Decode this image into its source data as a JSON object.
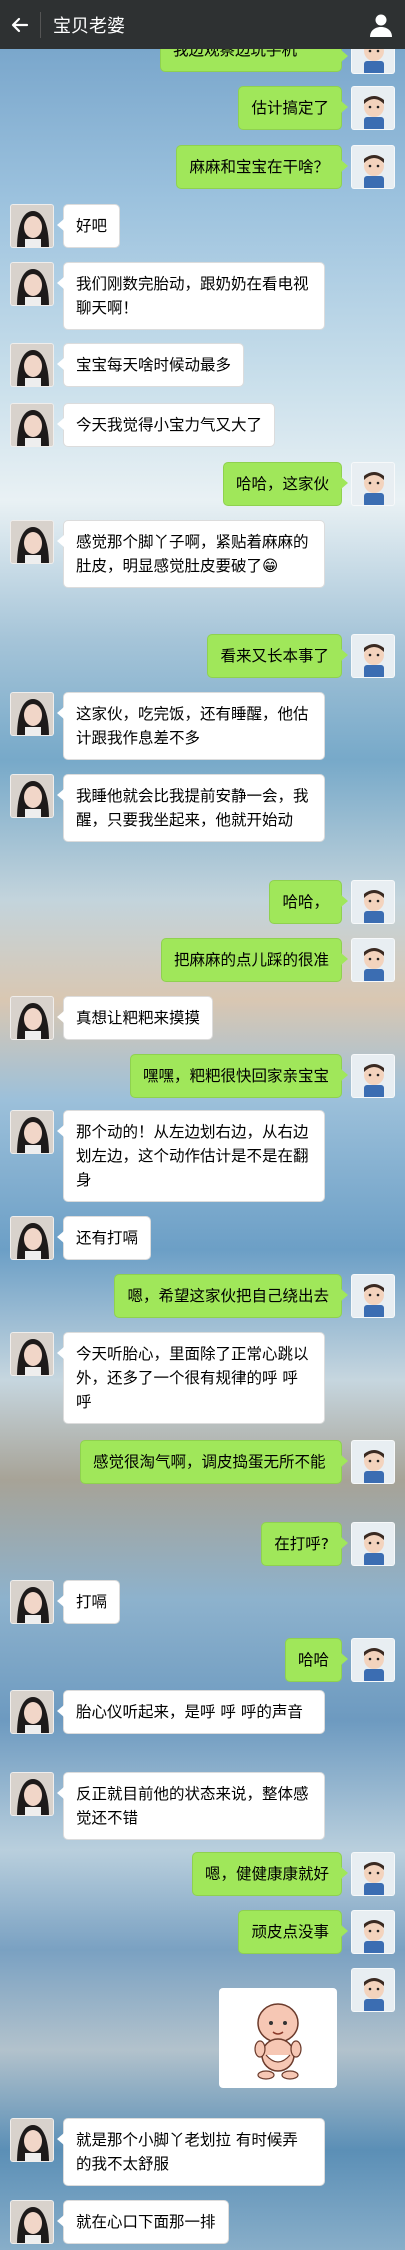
{
  "header": {
    "title": "宝贝老婆",
    "back_icon": "arrow-left-icon",
    "profile_icon": "person-icon"
  },
  "messages": [
    {
      "side": "right",
      "text": "我边观察边玩手机"
    },
    {
      "side": "right",
      "text": "估计搞定了"
    },
    {
      "side": "right",
      "text": "麻麻和宝宝在干啥？"
    },
    {
      "side": "left",
      "text": "好吧"
    },
    {
      "side": "left",
      "text": "我们刚数完胎动，跟奶奶在看电视聊天啊！"
    },
    {
      "side": "left",
      "text": "宝宝每天啥时候动最多"
    },
    {
      "side": "left",
      "text": "今天我觉得小宝力气又大了"
    },
    {
      "side": "right",
      "text": "哈哈，这家伙"
    },
    {
      "side": "left",
      "text": "感觉那个脚丫子啊，紧贴着麻麻的肚皮，明显感觉肚皮要破了😁"
    },
    {
      "side": "right",
      "text": "看来又长本事了"
    },
    {
      "side": "left",
      "text": "这家伙，吃完饭，还有睡醒，他估计跟我作息差不多"
    },
    {
      "side": "left",
      "text": "我睡他就会比我提前安静一会，我醒，只要我坐起来，他就开始动"
    },
    {
      "side": "right",
      "text": "哈哈，"
    },
    {
      "side": "right",
      "text": "把麻麻的点儿踩的很准"
    },
    {
      "side": "left",
      "text": "真想让粑粑来摸摸"
    },
    {
      "side": "right",
      "text": "嘿嘿，粑粑很快回家亲宝宝"
    },
    {
      "side": "left",
      "text": "那个动的！从左边划右边，从右边划左边，这个动作估计是不是在翻身"
    },
    {
      "side": "left",
      "text": "还有打嗝"
    },
    {
      "side": "right",
      "text": "嗯，希望这家伙把自己绕出去"
    },
    {
      "side": "left",
      "text": "今天听胎心，里面除了正常心跳以外，还多了一个很有规律的呼 呼 呼"
    },
    {
      "side": "right",
      "text": "感觉很淘气啊，调皮捣蛋无所不能"
    },
    {
      "side": "right",
      "text": "在打呼?"
    },
    {
      "side": "left",
      "text": "打嗝"
    },
    {
      "side": "right",
      "text": "哈哈"
    },
    {
      "side": "left",
      "text": "胎心仪听起来，是呼  呼  呼的声音"
    },
    {
      "side": "left",
      "text": "反正就目前他的状态来说，整体感觉还不错"
    },
    {
      "side": "right",
      "text": "嗯，健健康康就好"
    },
    {
      "side": "right",
      "text": "顽皮点没事"
    },
    {
      "side": "right",
      "sticker": "baby-cartoon-sticker"
    },
    {
      "side": "left",
      "text": "就是那个小脚丫老划拉 有时候弄的我不太舒服"
    },
    {
      "side": "left",
      "text": "就在心口下面那一排"
    }
  ]
}
